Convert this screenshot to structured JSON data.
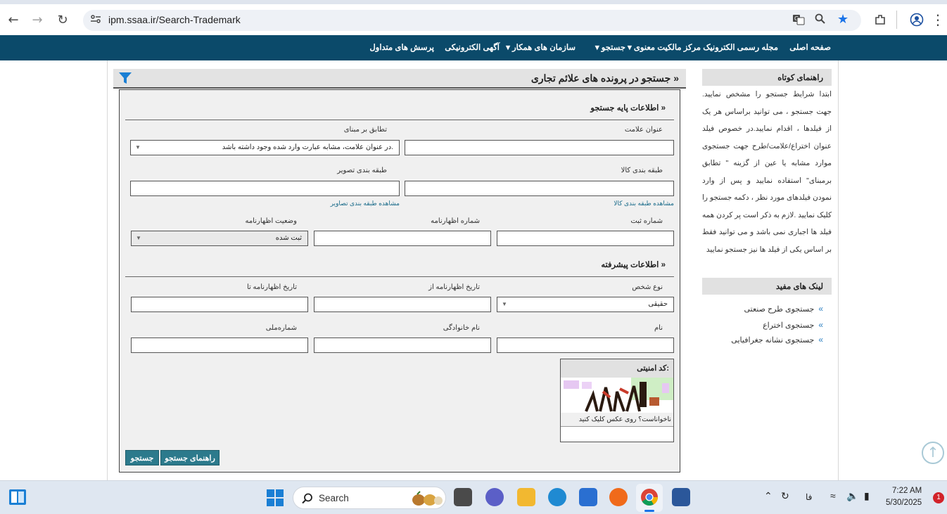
{
  "browser": {
    "url": "ipm.ssaa.ir/Search-Trademark"
  },
  "site_nav": {
    "items": [
      {
        "label": "صفحه اصلی",
        "dropdown": false
      },
      {
        "label": "مجله رسمی الکترونیک مرکز مالکیت معنوی",
        "dropdown": true
      },
      {
        "label": "جستجو",
        "dropdown": true
      },
      {
        "label": "سازمان های همکار",
        "dropdown": true
      },
      {
        "label": "آگهی الکترونیکی",
        "dropdown": false
      },
      {
        "label": "پرسش های متداول",
        "dropdown": false
      }
    ]
  },
  "sidebar": {
    "help_title": "راهنمای کوتاه",
    "help_text": "ابتدا شرایط جستجو را مشخص نمایید. جهت جستجو ، می توانید براساس هر یک از فیلدها ، اقدام نمایید.در خصوص فیلد عنوان اختراع/علامت/طرح جهت جستجوی موارد مشابه یا عین از گزینه \" تطابق برمبنای\" استفاده نمایید و پس از وارد نمودن فیلدهای مورد نظر ، دکمه جستجو را کلیک نمایید .لازم به ذکر است پر کردن همه فیلد ها اجباری نمی باشد و می توانید فقط بر اساس یکی از فیلد ها نیز جستجو نمایید",
    "links_title": "لینک های مفید",
    "links": [
      "جستجوی طرح صنعتی",
      "جستجوی اختراع",
      "جستجوی نشانه جغرافیایی"
    ]
  },
  "main": {
    "title": "جستجو در پرونده های علائم تجاری",
    "basic_section": "اطلاعات پایه جستجو",
    "advanced_section": "اطلاعات پیشرفته",
    "fields": {
      "mark_title": {
        "label": "عنوان علامت",
        "value": ""
      },
      "match_basis": {
        "label": "تطابق بر مبنای",
        "value": "در عنوان علامت، مشابه عبارت وارد شده وجود داشته باشد."
      },
      "goods_class": {
        "label": "طبقه بندی کالا",
        "value": "",
        "link": "مشاهده طبقه بندی کالا"
      },
      "image_class": {
        "label": "طبقه بندی تصویر",
        "value": "",
        "link": "مشاهده طبقه بندی تصاویر"
      },
      "reg_number": {
        "label": "شماره ثبت",
        "value": ""
      },
      "decl_number": {
        "label": "شماره اظهارنامه",
        "value": ""
      },
      "decl_status": {
        "label": "وضعیت اظهارنامه",
        "value": "ثبت شده"
      },
      "person_type": {
        "label": "نوع شخص",
        "value": "حقیقی"
      },
      "decl_date_from": {
        "label": "تاریخ اظهارنامه از",
        "value": ""
      },
      "decl_date_to": {
        "label": "تاریخ اظهارنامه تا",
        "value": ""
      },
      "first_name": {
        "label": "نام",
        "value": ""
      },
      "last_name": {
        "label": "نام خانوادگی",
        "value": ""
      },
      "national_id": {
        "label": "شماره‌ملی",
        "value": ""
      }
    },
    "captcha": {
      "title": "کد امنیتی:",
      "hint": "ناخواناست؟ روی عکس کلیک کنید",
      "value": ""
    },
    "buttons": {
      "search": "جستجو",
      "search_help": "راهنمای جستجو"
    }
  },
  "taskbar": {
    "search_placeholder": "Search",
    "lang": "فا",
    "time": "7:22 AM",
    "date": "5/30/2025",
    "notification_count": "1"
  },
  "colors": {
    "nav_bg": "#0b4a6a",
    "button_bg": "#2c7a8c",
    "link": "#1a6b8a",
    "accent_blue": "#1a73e8"
  }
}
